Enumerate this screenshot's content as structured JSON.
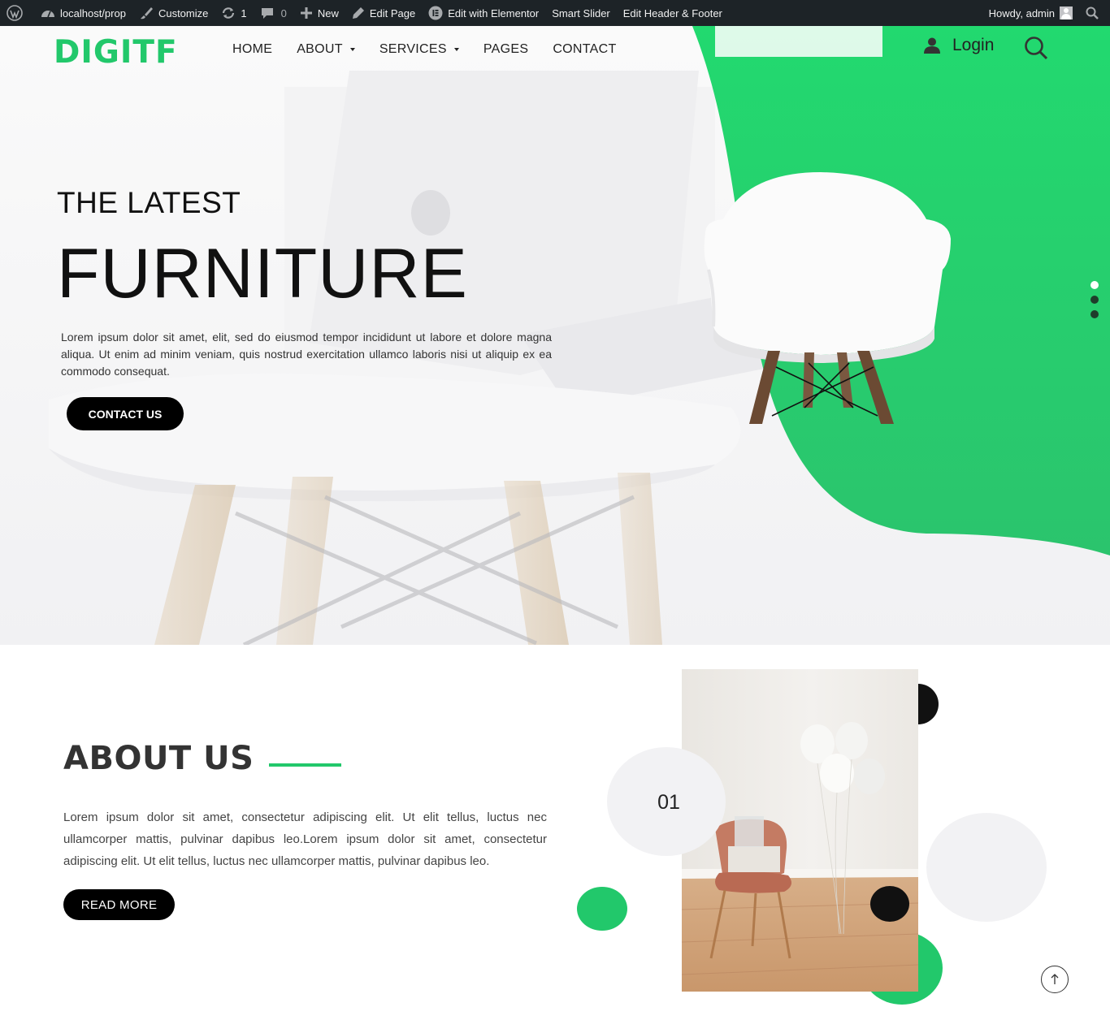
{
  "adminbar": {
    "site": "localhost/prop",
    "customize": "Customize",
    "updates_count": "1",
    "comments_count": "0",
    "new": "New",
    "edit_page": "Edit Page",
    "edit_elementor": "Edit with Elementor",
    "smart_slider": "Smart Slider",
    "edit_header_footer": "Edit Header & Footer",
    "howdy": "Howdy, admin"
  },
  "header": {
    "logo": "DIGITF",
    "nav": [
      "HOME",
      "ABOUT",
      "SERVICES",
      "PAGES",
      "CONTACT"
    ],
    "login": "Login"
  },
  "hero": {
    "kicker": "THE LATEST",
    "title": "FURNITURE",
    "description": "Lorem ipsum dolor sit amet, elit, sed do eiusmod tempor incididunt ut labore et dolore magna aliqua. Ut enim ad minim veniam, quis nostrud exercitation ullamco laboris nisi ut aliquip ex ea commodo consequat.",
    "button": "CONTACT US",
    "slides_total": 3,
    "slide_active": 1
  },
  "about": {
    "title": "ABOUT US",
    "text": "Lorem ipsum dolor sit amet, consectetur adipiscing elit. Ut elit tellus, luctus nec ullamcorper mattis, pulvinar dapibus leo.Lorem ipsum dolor sit amet, consectetur adipiscing elit. Ut elit tellus, luctus nec ullamcorper mattis, pulvinar dapibus leo.",
    "button": "READ MORE",
    "number": "01"
  },
  "colors": {
    "accent": "#22c86b",
    "adminbar": "#1d2327",
    "button": "#000000"
  },
  "icons": [
    "wordpress-icon",
    "dashboard-icon",
    "brush-icon",
    "updates-icon",
    "comment-icon",
    "plus-icon",
    "pencil-icon",
    "elementor-icon",
    "user-icon",
    "search-icon",
    "arrow-up-icon"
  ]
}
